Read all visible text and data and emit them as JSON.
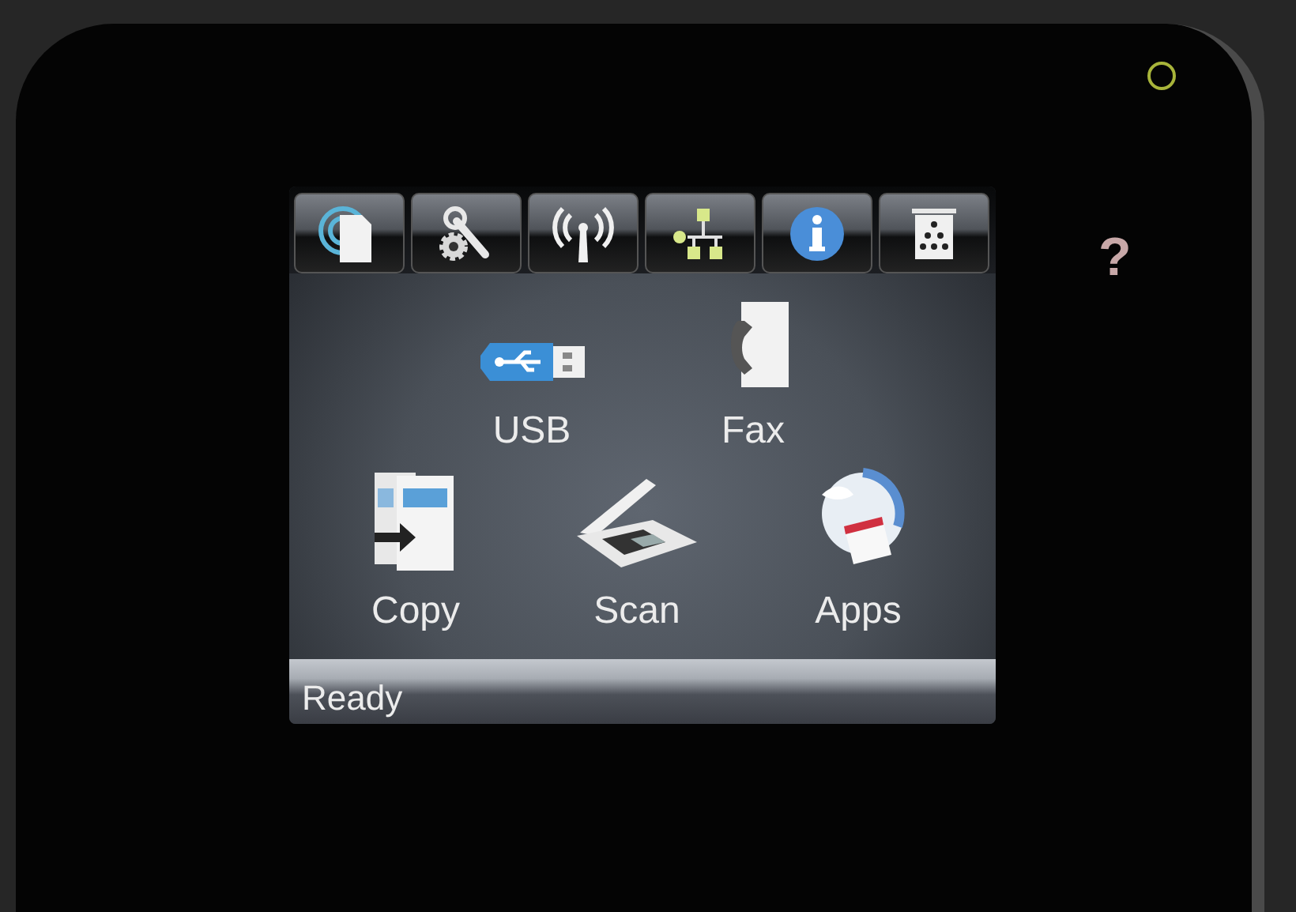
{
  "power_light": {
    "on": true
  },
  "screen": {
    "toolbar": [
      {
        "kind": "web-services"
      },
      {
        "kind": "setup"
      },
      {
        "kind": "wireless"
      },
      {
        "kind": "network"
      },
      {
        "kind": "info"
      },
      {
        "kind": "supplies"
      }
    ],
    "app_rows": [
      [
        {
          "label": "USB",
          "kind": "usb"
        },
        {
          "label": "Fax",
          "kind": "fax"
        }
      ],
      [
        {
          "label": "Copy",
          "kind": "copy"
        },
        {
          "label": "Scan",
          "kind": "scan"
        },
        {
          "label": "Apps",
          "kind": "apps"
        }
      ]
    ],
    "status_bar": {
      "text": "Ready"
    }
  },
  "help_button": {
    "label": "?"
  }
}
